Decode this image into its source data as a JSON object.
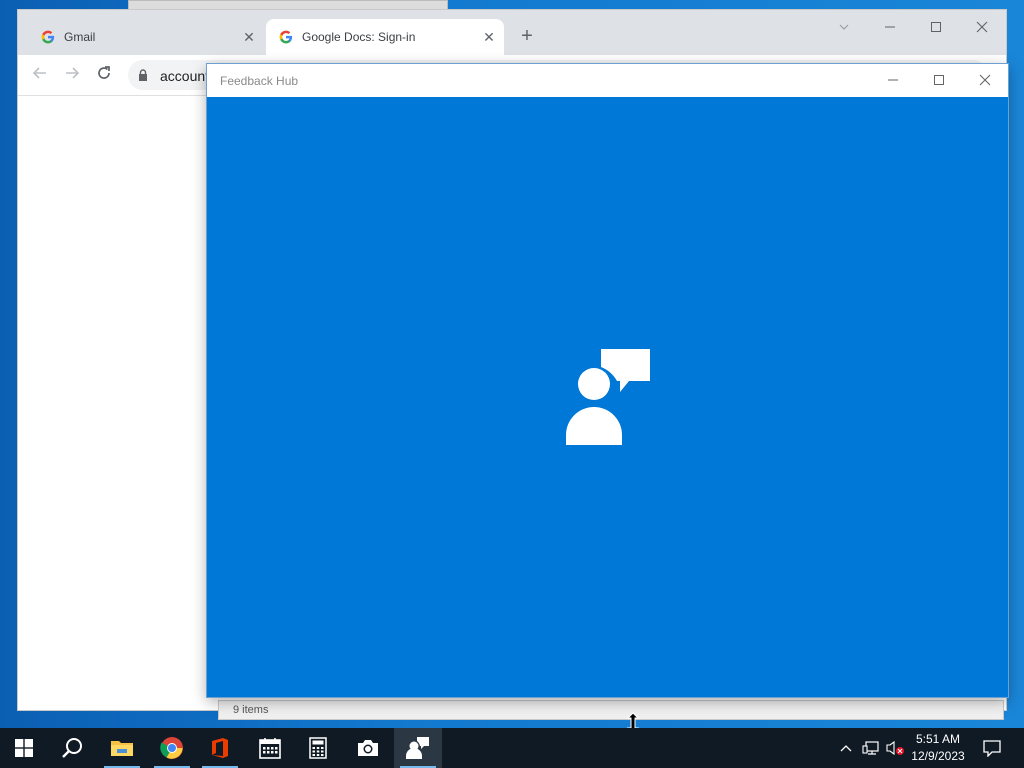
{
  "chrome": {
    "tabs": [
      {
        "label": "Gmail",
        "active": false
      },
      {
        "label": "Google Docs: Sign-in",
        "active": true
      }
    ],
    "close_glyph": "✕",
    "new_tab_glyph": "+",
    "address": "account",
    "window_controls": [
      "chevron-down",
      "minimize",
      "maximize",
      "close"
    ]
  },
  "feedback_hub": {
    "title": "Feedback Hub",
    "background_color": "#0078d7",
    "splash_icon": "person-speech-bubble-icon"
  },
  "explorer": {
    "status_text": "9 items"
  },
  "taskbar": {
    "items": [
      {
        "name": "start-button",
        "icon": "windows-logo-icon"
      },
      {
        "name": "search-button",
        "icon": "search-icon"
      },
      {
        "name": "file-explorer",
        "icon": "folder-icon",
        "running": true
      },
      {
        "name": "chrome",
        "icon": "chrome-icon",
        "running": true
      },
      {
        "name": "office",
        "icon": "office-icon",
        "running": true
      },
      {
        "name": "calendar",
        "icon": "calendar-icon"
      },
      {
        "name": "calculator",
        "icon": "calculator-icon"
      },
      {
        "name": "camera",
        "icon": "camera-icon"
      },
      {
        "name": "feedback-hub",
        "icon": "feedback-hub-icon",
        "running": true,
        "active": true
      }
    ],
    "clock": {
      "time": "5:51 AM",
      "date": "12/9/2023"
    }
  },
  "colors": {
    "taskbar": "#101a24",
    "accent": "#0078d7"
  }
}
